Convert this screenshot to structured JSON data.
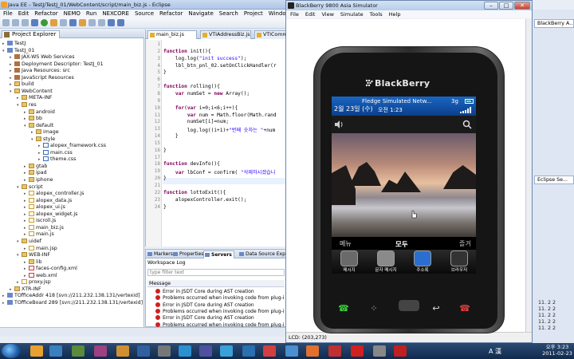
{
  "eclipse": {
    "title": "Java EE - TestJ/TestJ_01/WebContent/script/main_biz.js - Eclipse",
    "menu": [
      "File",
      "Edit",
      "Refactor",
      "NEMO",
      "Run",
      "NEXCORE",
      "Source",
      "Refactor",
      "Navigate",
      "Search",
      "Project",
      "Window",
      "Help"
    ],
    "project_explorer": {
      "tab_label": "Project Explorer",
      "tree": [
        {
          "label": "TestJ",
          "depth": 0,
          "icon": "proj",
          "open": false
        },
        {
          "label": "TestJ_01",
          "depth": 0,
          "icon": "proj",
          "open": true
        },
        {
          "label": "JAX-WS Web Services",
          "depth": 1,
          "icon": "pkg",
          "open": false
        },
        {
          "label": "Deployment Descriptor: TestJ_01",
          "depth": 1,
          "icon": "pkg",
          "open": false
        },
        {
          "label": "Java Resources: src",
          "depth": 1,
          "icon": "pkg",
          "open": false
        },
        {
          "label": "JavaScript Resources",
          "depth": 1,
          "icon": "pkg",
          "open": false
        },
        {
          "label": "build",
          "depth": 1,
          "icon": "folder",
          "open": false
        },
        {
          "label": "WebContent",
          "depth": 1,
          "icon": "folder",
          "open": true
        },
        {
          "label": "META-INF",
          "depth": 2,
          "icon": "folder",
          "open": false
        },
        {
          "label": "res",
          "depth": 2,
          "icon": "folder",
          "open": true
        },
        {
          "label": "android",
          "depth": 3,
          "icon": "folder",
          "open": false
        },
        {
          "label": "bb",
          "depth": 3,
          "icon": "folder",
          "open": false
        },
        {
          "label": "default",
          "depth": 3,
          "icon": "folder",
          "open": true
        },
        {
          "label": "image",
          "depth": 4,
          "icon": "folder",
          "open": false
        },
        {
          "label": "style",
          "depth": 4,
          "icon": "folder",
          "open": true
        },
        {
          "label": "alopex_framework.css",
          "depth": 5,
          "icon": "cssfile",
          "open": false
        },
        {
          "label": "main.css",
          "depth": 5,
          "icon": "cssfile",
          "open": false
        },
        {
          "label": "theme.css",
          "depth": 5,
          "icon": "cssfile",
          "open": false
        },
        {
          "label": "gtab",
          "depth": 3,
          "icon": "folder",
          "open": false
        },
        {
          "label": "ipad",
          "depth": 3,
          "icon": "folder",
          "open": false
        },
        {
          "label": "iphone",
          "depth": 3,
          "icon": "folder",
          "open": false
        },
        {
          "label": "script",
          "depth": 2,
          "icon": "folder",
          "open": true
        },
        {
          "label": "alopex_controller.js",
          "depth": 3,
          "icon": "jsfile",
          "open": false
        },
        {
          "label": "alopex_data.js",
          "depth": 3,
          "icon": "jsfile",
          "open": false
        },
        {
          "label": "alopex_ui.js",
          "depth": 3,
          "icon": "jsfile",
          "open": false
        },
        {
          "label": "alopex_widget.js",
          "depth": 3,
          "icon": "jsfile",
          "open": false
        },
        {
          "label": "iscroll.js",
          "depth": 3,
          "icon": "jsfile",
          "open": false
        },
        {
          "label": "main_biz.js",
          "depth": 3,
          "icon": "jsfile",
          "open": false
        },
        {
          "label": "main.js",
          "depth": 3,
          "icon": "jsfile",
          "open": false
        },
        {
          "label": "uidef",
          "depth": 2,
          "icon": "folder",
          "open": true
        },
        {
          "label": "main.jsp",
          "depth": 3,
          "icon": "jsfile",
          "open": false
        },
        {
          "label": "WEB-INF",
          "depth": 2,
          "icon": "folder",
          "open": true
        },
        {
          "label": "lib",
          "depth": 3,
          "icon": "folder",
          "open": false
        },
        {
          "label": "faces-config.xml",
          "depth": 3,
          "icon": "xmlfile",
          "open": false
        },
        {
          "label": "web.xml",
          "depth": 3,
          "icon": "xmlfile",
          "open": false
        },
        {
          "label": "proxy.jsp",
          "depth": 2,
          "icon": "jsfile",
          "open": false
        },
        {
          "label": "XTR-INF",
          "depth": 1,
          "icon": "folder",
          "open": false
        },
        {
          "label": "TOfficeAddr 418 [svn://211.232.138.131/vertexid]",
          "depth": 0,
          "icon": "proj",
          "open": false
        },
        {
          "label": "TOfficeBoard 289 [svn://211.232.138.131/vertexid]",
          "depth": 0,
          "icon": "proj",
          "open": false
        }
      ]
    },
    "editor": {
      "tabs": [
        "main_biz.js",
        "VTIAddressBiz.js",
        "VTICommon"
      ],
      "active_tab": 0,
      "lines": [
        {
          "n": "1",
          "code": ""
        },
        {
          "n": "2",
          "code": "function init(){"
        },
        {
          "n": "3",
          "code": "    log.log(\"init success\");"
        },
        {
          "n": "4",
          "code": "    lbl_btn_pnl_02.setOnClickHandler(r"
        },
        {
          "n": "5",
          "code": "}"
        },
        {
          "n": "6",
          "code": ""
        },
        {
          "n": "7",
          "code": "function rolling(){"
        },
        {
          "n": "8",
          "code": "    var numSet = new Array();"
        },
        {
          "n": "9",
          "code": ""
        },
        {
          "n": "10",
          "code": "    for(var i=0;i<6;i++){"
        },
        {
          "n": "11",
          "code": "        var num = Math.floor(Math.rand"
        },
        {
          "n": "12",
          "code": "        numSet[i]=num;"
        },
        {
          "n": "13",
          "code": "        log.log((i+1)+\"번째 숫자는 \"+num"
        },
        {
          "n": "14",
          "code": "    }"
        },
        {
          "n": "15",
          "code": ""
        },
        {
          "n": "16",
          "code": "}"
        },
        {
          "n": "17",
          "code": ""
        },
        {
          "n": "18",
          "code": "function devInfo(){"
        },
        {
          "n": "19",
          "code": "    var lbConf = confirm( \"삭제하시겠습니"
        },
        {
          "n": "20",
          "code": "}"
        },
        {
          "n": "21",
          "code": ""
        },
        {
          "n": "22",
          "code": "function lottoExit(){"
        },
        {
          "n": "23",
          "code": "    alopexController.exit();"
        },
        {
          "n": "24",
          "code": "}"
        }
      ]
    },
    "bottom_panel": {
      "tabs": [
        "Markers",
        "Properties",
        "Servers",
        "Data Source Explorer"
      ],
      "active_tab": 2,
      "title": "Workspace Log",
      "filter_placeholder": "type filter text",
      "column": "Message",
      "rows": [
        "Error in JSDT Core during AST creation",
        "Problems occurred when invoking code from plug-in: \"",
        "Error in JSDT Core during AST creation",
        "Problems occurred when invoking code from plug-in: \"",
        "Error in JSDT Core during AST creation",
        "Problems occurred when invoking code from plug-in: \"",
        "Error in JSDT Core during reconcile"
      ]
    },
    "right_strip": {
      "tab_top": "BlackBerry A...",
      "tab_mid": "Eclipse Se...",
      "numbers": [
        "11. 2 2",
        "11. 2 2",
        "11. 2 2",
        "11. 2 2",
        "11. 2 2"
      ]
    }
  },
  "simulator": {
    "title": "BlackBerry 9800 Asia Simulator",
    "menu": [
      "File",
      "Edit",
      "View",
      "Simulate",
      "Tools",
      "Help"
    ],
    "lcd_status": "LCD: (203,273)",
    "brand": "BlackBerry",
    "screen": {
      "date": "2월 23일 (수)",
      "ticker": "Fledge Simulated Netw...",
      "time": "오전 1:23",
      "network": "3g",
      "menu_label": "메뉴",
      "all_label": "모두",
      "fav_label": "즐겨",
      "apps": [
        {
          "name": "메시지",
          "color": "#6a6a6a"
        },
        {
          "name": "문자 메시지",
          "color": "#8a8a8a"
        },
        {
          "name": "주소록",
          "color": "#2a6fd0"
        },
        {
          "name": "브라우저",
          "color": "#333333"
        }
      ]
    }
  },
  "taskbar": {
    "ime": "A 漢",
    "time": "오후 3:23",
    "date": "2011-02-23"
  }
}
